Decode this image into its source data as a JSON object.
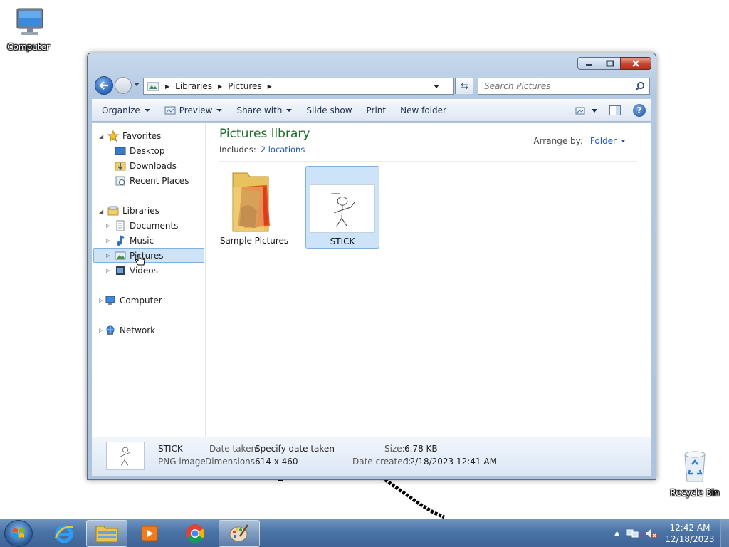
{
  "desktop": {
    "computer_label": "Computer",
    "recycle_label": "Recycle Bin"
  },
  "window": {
    "address": {
      "segments": [
        "Libraries",
        "Pictures"
      ]
    },
    "search_placeholder": "Search Pictures",
    "commands": {
      "organize": "Organize",
      "preview": "Preview",
      "share_with": "Share with",
      "slide_show": "Slide show",
      "print": "Print",
      "new_folder": "New folder"
    },
    "nav": {
      "favorites": "Favorites",
      "desktop": "Desktop",
      "downloads": "Downloads",
      "recent_places": "Recent Places",
      "libraries": "Libraries",
      "documents": "Documents",
      "music": "Music",
      "pictures": "Pictures",
      "videos": "Videos",
      "computer": "Computer",
      "network": "Network"
    },
    "library": {
      "title": "Pictures library",
      "includes_label": "Includes:",
      "includes_link": "2 locations",
      "arrange_label": "Arrange by:",
      "arrange_value": "Folder"
    },
    "items": [
      {
        "name": "Sample Pictures",
        "type": "folder",
        "selected": false
      },
      {
        "name": "STICK",
        "type": "image",
        "selected": true
      }
    ],
    "details": {
      "name": "STICK",
      "type": "PNG image",
      "date_taken_label": "Date taken:",
      "date_taken_value": "Specify date taken",
      "dimensions_label": "Dimensions:",
      "dimensions_value": "614 x 460",
      "size_label": "Size:",
      "size_value": "6.78 KB",
      "created_label": "Date created:",
      "created_value": "12/18/2023 12:41 AM"
    }
  },
  "taskbar": {
    "time": "12:42 AM",
    "date": "12/18/2023",
    "apps": [
      "start-orb",
      "internet-explorer-icon",
      "windows-explorer-icon",
      "media-player-icon",
      "chrome-icon",
      "paint-icon"
    ]
  },
  "colors": {
    "library_title": "#1e6a2e",
    "link": "#1f59b8",
    "selection": "#cde3f7",
    "taskbar": "#4a73a6"
  }
}
